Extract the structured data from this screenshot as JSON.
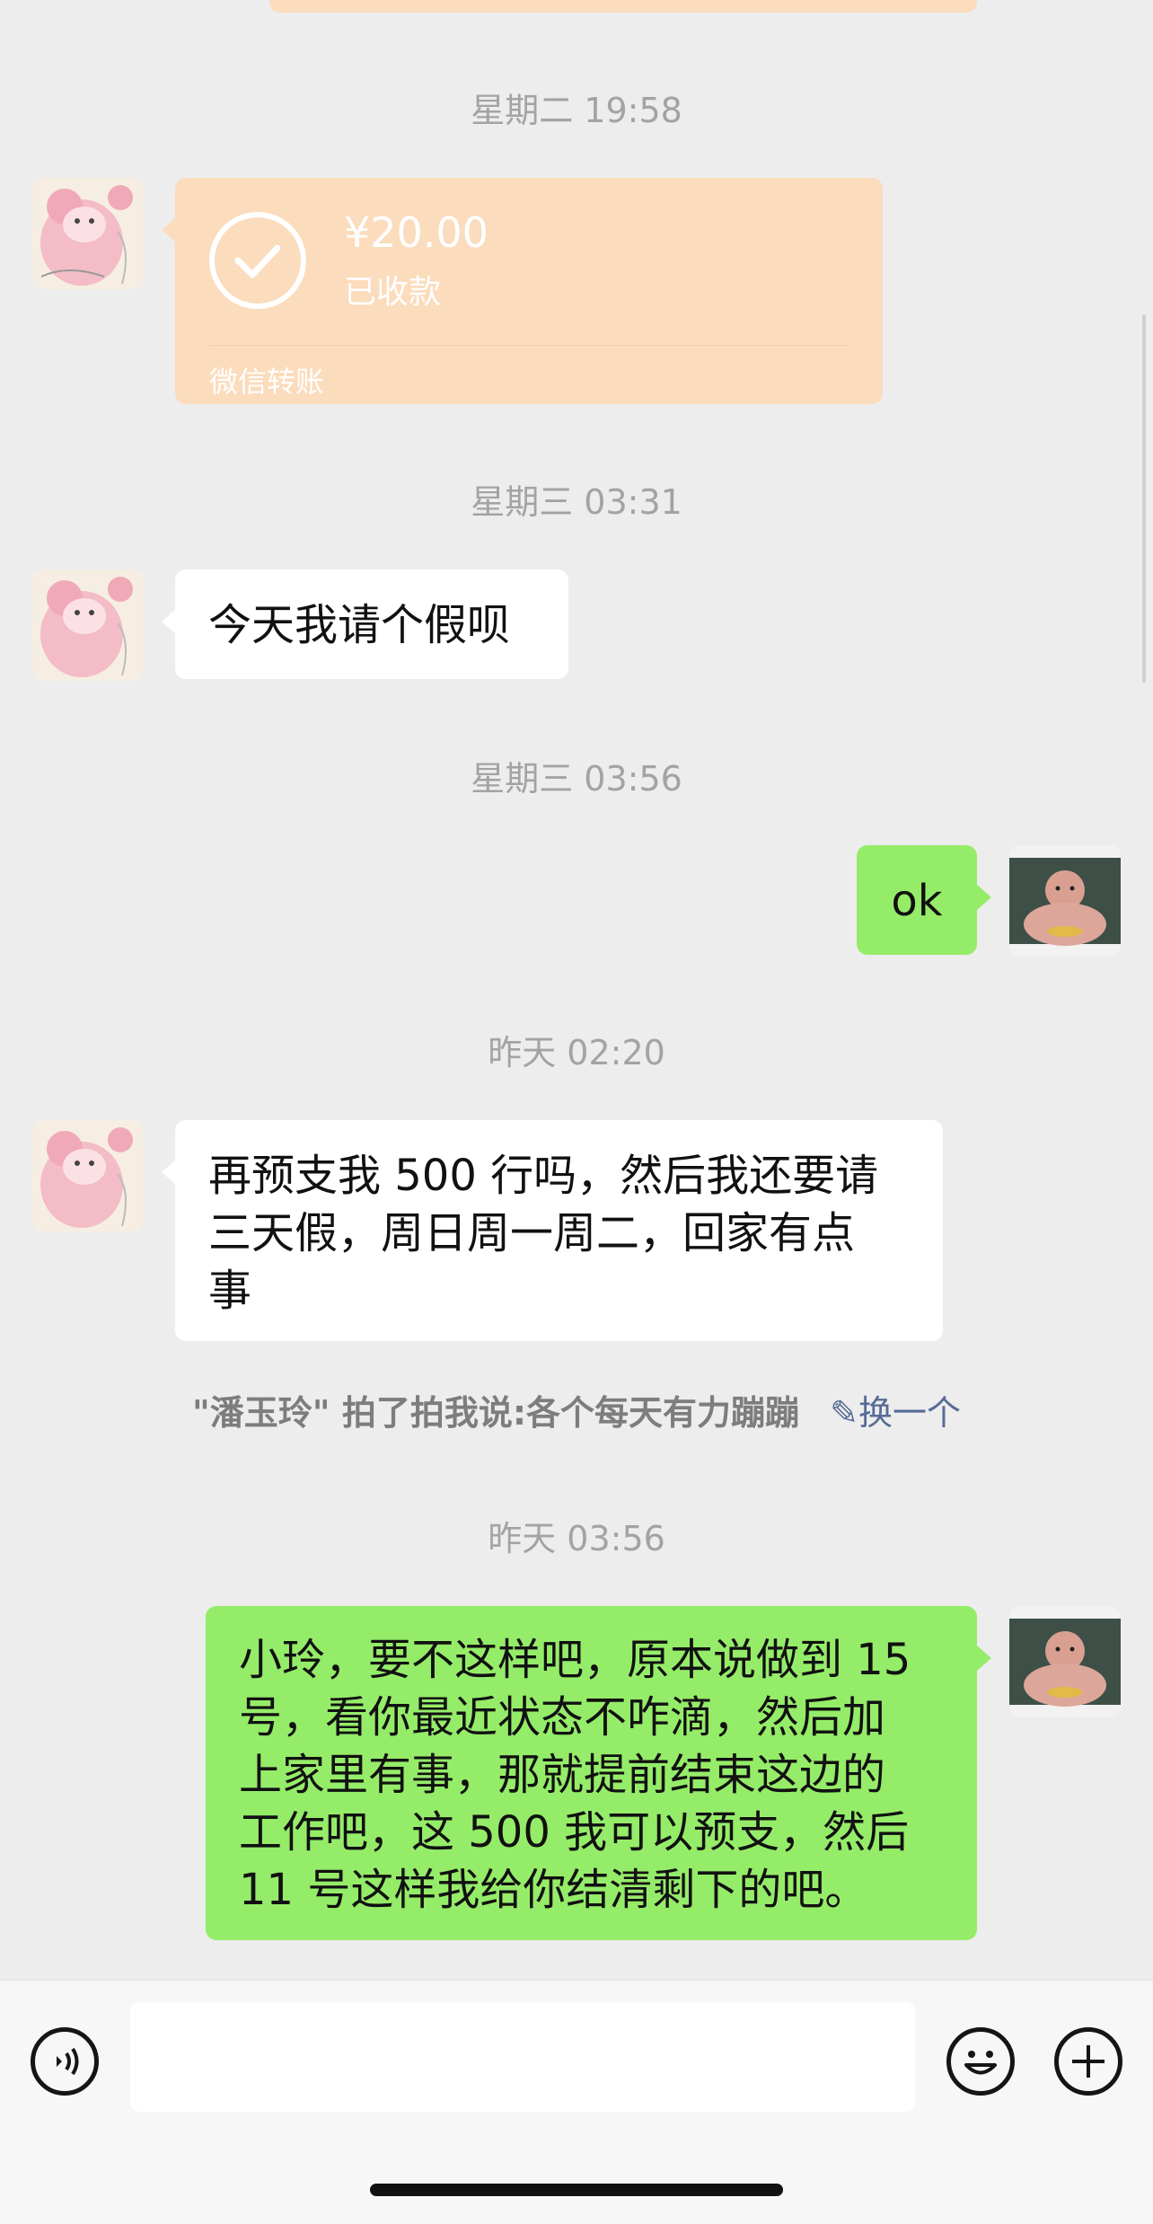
{
  "messages": {
    "ts1": "星期二 19:58",
    "transfer": {
      "amount": "¥20.00",
      "status": "已收款",
      "footer": "微信转账"
    },
    "ts2": "星期三 03:31",
    "msg1": "今天我请个假呗",
    "ts3": "星期三 03:56",
    "msg2": "ok",
    "ts4": "昨天 02:20",
    "msg3": [
      "再预支我 500 行吗，然后我还要请",
      "三天假，周日周一周二，回家有点",
      "事"
    ],
    "pat_text": "\"潘玉玲\" 拍了拍我说:各个每天有力蹦蹦",
    "pat_action": "换一个",
    "ts5": "昨天 03:56",
    "msg4": [
      "小玲，要不这样吧，原本说做到 15",
      "号，看你最近状态不咋滴，然后加",
      "上家里有事，那就提前结束这边的",
      "工作吧，这 500 我可以预支，然后",
      "11 号这样我给你结清剩下的吧。"
    ]
  },
  "icons": {
    "voice": "voice-icon",
    "emoji": "emoji-icon",
    "plus": "plus-icon",
    "check": "check-icon",
    "edit": "edit-icon"
  },
  "colors": {
    "background": "#ededed",
    "incoming_bubble": "#ffffff",
    "outgoing_bubble": "#95ec69",
    "transfer_bubble": "#fbdcbd",
    "timestamp": "#a3a3a3",
    "link": "#576b95"
  }
}
